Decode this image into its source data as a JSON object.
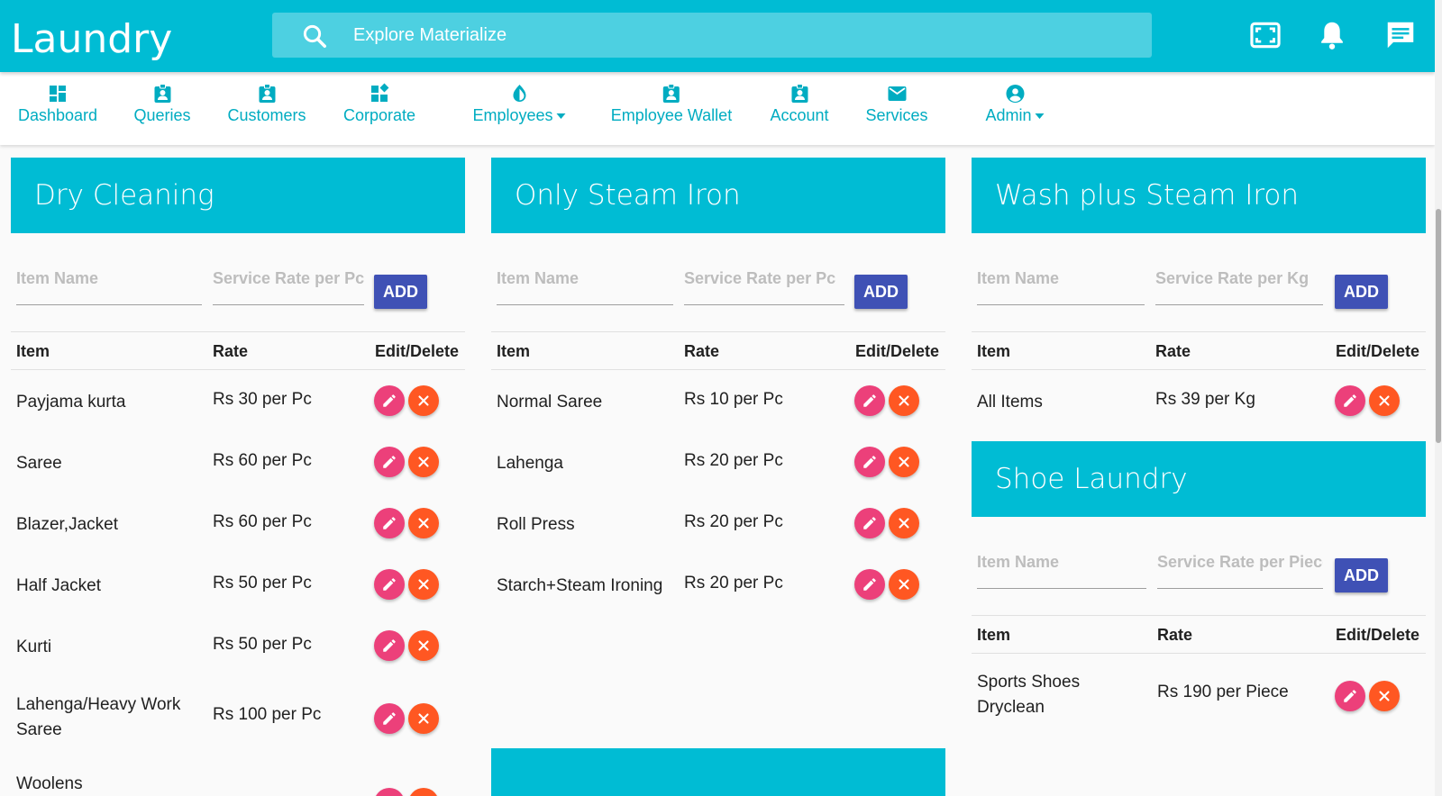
{
  "app": {
    "title": "Laundry"
  },
  "search": {
    "placeholder": "Explore Materialize"
  },
  "header_icons": [
    "fullscreen-icon",
    "notifications-icon",
    "chat-icon"
  ],
  "nav": {
    "items": [
      {
        "label": "Dashboard",
        "icon": "dashboard-icon"
      },
      {
        "label": "Queries",
        "icon": "badge-icon"
      },
      {
        "label": "Customers",
        "icon": "badge-icon"
      },
      {
        "label": "Corporate",
        "icon": "widgets-icon"
      },
      {
        "label": "Employees",
        "icon": "drop-icon",
        "dropdown": true
      },
      {
        "label": "Employee Wallet",
        "icon": "badge-icon"
      },
      {
        "label": "Account",
        "icon": "badge-icon"
      },
      {
        "label": "Services",
        "icon": "mail-icon"
      },
      {
        "label": "Admin",
        "icon": "account-circle-icon",
        "dropdown": true
      }
    ]
  },
  "table_headers": {
    "item": "Item",
    "rate": "Rate",
    "actions": "Edit/Delete"
  },
  "add_label": "ADD",
  "cards": {
    "dry_cleaning": {
      "title": "Dry Cleaning",
      "item_placeholder": "Item Name",
      "rate_placeholder": "Service Rate per Pc",
      "rows": [
        {
          "item": "Payjama kurta",
          "rate": "Rs 30 per Pc"
        },
        {
          "item": "Saree",
          "rate": "Rs 60 per Pc"
        },
        {
          "item": "Blazer,Jacket",
          "rate": "Rs 60 per Pc"
        },
        {
          "item": "Half Jacket",
          "rate": "Rs 50 per Pc"
        },
        {
          "item": "Kurti",
          "rate": "Rs 50 per Pc"
        },
        {
          "item": "Lahenga/Heavy Work Saree",
          "rate": "Rs 100 per Pc"
        },
        {
          "item": "Woolens",
          "rate": ""
        }
      ]
    },
    "only_steam_iron": {
      "title": "Only Steam Iron",
      "item_placeholder": "Item Name",
      "rate_placeholder": "Service Rate per Pc",
      "rows": [
        {
          "item": "Normal Saree",
          "rate": "Rs 10 per Pc"
        },
        {
          "item": "Lahenga",
          "rate": "Rs 20 per Pc"
        },
        {
          "item": "Roll Press",
          "rate": "Rs 20 per Pc"
        },
        {
          "item": "Starch+Steam Ironing",
          "rate": "Rs 20 per Pc"
        }
      ]
    },
    "wash_plus_steam_iron": {
      "title": "Wash plus Steam Iron",
      "item_placeholder": "Item Name",
      "rate_placeholder": "Service Rate per Kg",
      "rows": [
        {
          "item": "All Items",
          "rate": "Rs 39 per Kg"
        }
      ]
    },
    "shoe_laundry": {
      "title": "Shoe Laundry",
      "item_placeholder": "Item Name",
      "rate_placeholder": "Service Rate per Piece",
      "rows": [
        {
          "item": "Sports Shoes Dryclean",
          "rate": "Rs 190 per Piece"
        }
      ]
    }
  },
  "colors": {
    "primary": "#00bcd4",
    "nav_text": "#00acc1",
    "add_button": "#3f51b5",
    "edit_button": "#ec407a",
    "delete_button": "#ff5722"
  }
}
